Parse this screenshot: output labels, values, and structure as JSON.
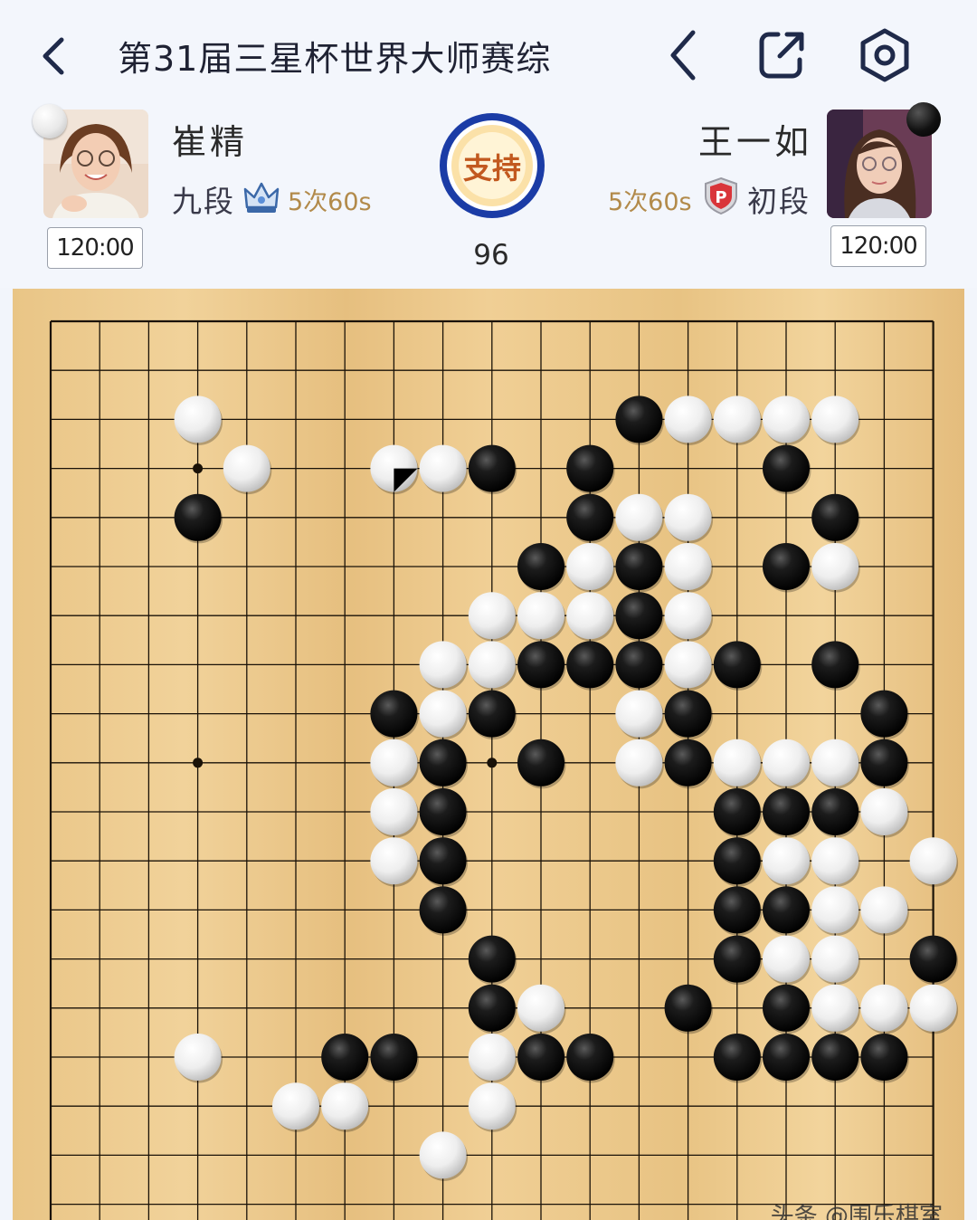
{
  "header": {
    "title": "第31届三星杯世界大师赛综",
    "back_icon": "chevron-left-icon",
    "toolbar_icons": [
      "chevron-left-icon",
      "share-icon",
      "settings-icon"
    ]
  },
  "players": {
    "white": {
      "name": "崔精",
      "rank": "九段",
      "rank_badge": "crown-icon",
      "byoyomi": "5次60s",
      "clock": "120:00",
      "stone": "white"
    },
    "black": {
      "name": "王一如",
      "rank": "初段",
      "rank_badge": "p-shield-icon",
      "byoyomi": "5次60s",
      "clock": "120:00",
      "stone": "black"
    }
  },
  "support": {
    "label": "支持"
  },
  "move_number": "96",
  "board": {
    "visible_columns": 19,
    "visible_rows": 18,
    "star_points": [
      [
        3,
        3
      ],
      [
        3,
        9
      ],
      [
        9,
        9
      ]
    ],
    "last_move": [
      7,
      3
    ],
    "black": [
      [
        12,
        2
      ],
      [
        3,
        4
      ],
      [
        9,
        3
      ],
      [
        11,
        3
      ],
      [
        15,
        3
      ],
      [
        11,
        4
      ],
      [
        16,
        4
      ],
      [
        10,
        5
      ],
      [
        12,
        5
      ],
      [
        15,
        5
      ],
      [
        12,
        6
      ],
      [
        10,
        7
      ],
      [
        11,
        7
      ],
      [
        12,
        7
      ],
      [
        14,
        7
      ],
      [
        16,
        7
      ],
      [
        7,
        8
      ],
      [
        9,
        8
      ],
      [
        13,
        8
      ],
      [
        17,
        8
      ],
      [
        8,
        9
      ],
      [
        10,
        9
      ],
      [
        13,
        9
      ],
      [
        17,
        9
      ],
      [
        8,
        10
      ],
      [
        14,
        10
      ],
      [
        15,
        10
      ],
      [
        16,
        10
      ],
      [
        8,
        11
      ],
      [
        14,
        11
      ],
      [
        8,
        12
      ],
      [
        14,
        12
      ],
      [
        15,
        12
      ],
      [
        9,
        13
      ],
      [
        14,
        13
      ],
      [
        18,
        13
      ],
      [
        9,
        14
      ],
      [
        13,
        14
      ],
      [
        15,
        14
      ],
      [
        6,
        15
      ],
      [
        7,
        15
      ],
      [
        10,
        15
      ],
      [
        11,
        15
      ],
      [
        14,
        15
      ],
      [
        15,
        15
      ],
      [
        16,
        15
      ],
      [
        17,
        15
      ]
    ],
    "white": [
      [
        3,
        2
      ],
      [
        13,
        2
      ],
      [
        14,
        2
      ],
      [
        15,
        2
      ],
      [
        16,
        2
      ],
      [
        4,
        3
      ],
      [
        7,
        3
      ],
      [
        8,
        3
      ],
      [
        12,
        4
      ],
      [
        13,
        4
      ],
      [
        11,
        5
      ],
      [
        13,
        5
      ],
      [
        16,
        5
      ],
      [
        9,
        6
      ],
      [
        10,
        6
      ],
      [
        11,
        6
      ],
      [
        13,
        6
      ],
      [
        8,
        7
      ],
      [
        9,
        7
      ],
      [
        13,
        7
      ],
      [
        8,
        8
      ],
      [
        12,
        8
      ],
      [
        7,
        9
      ],
      [
        12,
        9
      ],
      [
        14,
        9
      ],
      [
        15,
        9
      ],
      [
        16,
        9
      ],
      [
        7,
        10
      ],
      [
        17,
        10
      ],
      [
        7,
        11
      ],
      [
        15,
        11
      ],
      [
        16,
        11
      ],
      [
        18,
        11
      ],
      [
        16,
        12
      ],
      [
        17,
        12
      ],
      [
        15,
        13
      ],
      [
        16,
        13
      ],
      [
        10,
        14
      ],
      [
        16,
        14
      ],
      [
        17,
        14
      ],
      [
        18,
        14
      ],
      [
        3,
        15
      ],
      [
        9,
        15
      ],
      [
        5,
        16
      ],
      [
        6,
        16
      ],
      [
        9,
        16
      ],
      [
        8,
        17
      ]
    ]
  },
  "watermark": "头条 @围乐棋室"
}
